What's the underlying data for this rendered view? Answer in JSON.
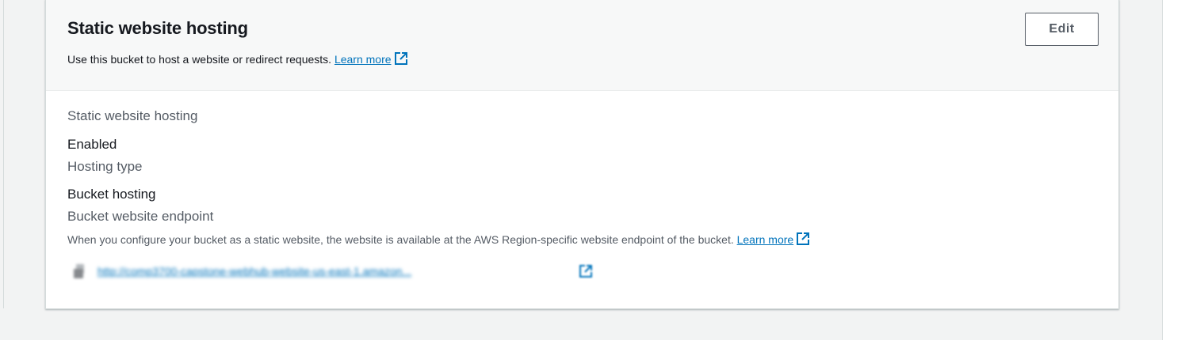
{
  "panel": {
    "title": "Static website hosting",
    "description": "Use this bucket to host a website or redirect requests.",
    "learn_more": "Learn more",
    "edit_label": "Edit"
  },
  "fields": {
    "hosting_label": "Static website hosting",
    "hosting_value": "Enabled",
    "type_label": "Hosting type",
    "type_value": "Bucket hosting",
    "endpoint_label": "Bucket website endpoint",
    "endpoint_description": "When you configure your bucket as a static website, the website is available at the AWS Region-specific website endpoint of the bucket.",
    "endpoint_learn_more": "Learn more",
    "endpoint_url": "http://comp3700-capstone-webhub-website-us-east-1.amazon..."
  },
  "colors": {
    "link": "#0073bb",
    "text": "#16191f",
    "secondary_text": "#545b64",
    "header_bg": "#f7f8f8",
    "page_bg": "#f2f3f3"
  },
  "icons": {
    "external_link": "external-link-icon",
    "copy": "copy-icon"
  }
}
